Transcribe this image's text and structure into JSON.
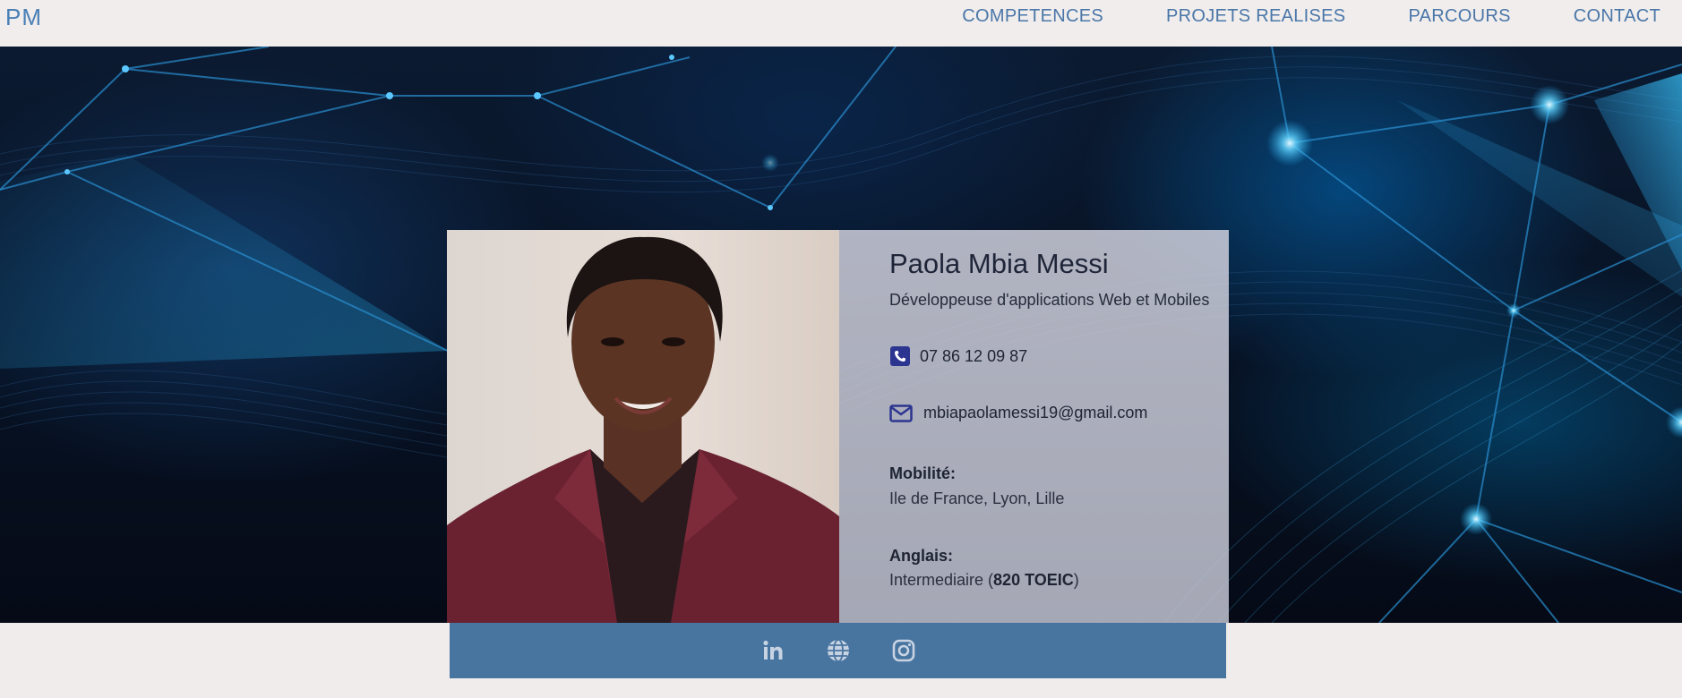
{
  "nav": {
    "logo": "PM",
    "links": [
      {
        "label": "COMPETENCES"
      },
      {
        "label": "PROJETS REALISES"
      },
      {
        "label": "PARCOURS"
      },
      {
        "label": "CONTACT"
      }
    ]
  },
  "profile": {
    "name": "Paola Mbia Messi",
    "role": "Développeuse d'applications Web et Mobiles",
    "phone": "07 86 12 09 87",
    "email": "mbiapaolamessi19@gmail.com",
    "mobility_label": "Mobilité:",
    "mobility_value": "Ile de France, Lyon, Lille",
    "english_label": "Anglais:",
    "english_prefix": "Intermediaire (",
    "english_score": "820 TOEIC",
    "english_suffix": ")"
  },
  "social": [
    {
      "icon": "linkedin-icon"
    },
    {
      "icon": "globe-icon"
    },
    {
      "icon": "instagram-icon"
    }
  ],
  "colors": {
    "accent": "#4a76a8",
    "social_bar": "#4874a0",
    "icon_navy": "#2c3590"
  }
}
